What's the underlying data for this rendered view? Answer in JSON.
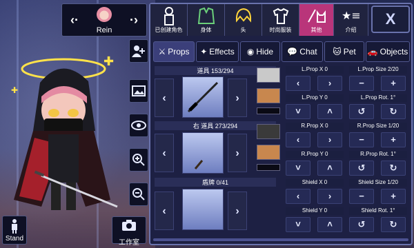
{
  "character": {
    "name": "Rein",
    "prev_icon": "chevron-left-icon",
    "next_icon": "chevron-right-icon"
  },
  "stand": {
    "label": "Stand"
  },
  "camera": {
    "label": "工作室"
  },
  "side_buttons": [
    "add-person-icon",
    "image-icon",
    "eye-icon",
    "zoom-in-icon",
    "zoom-out-icon"
  ],
  "categories": [
    {
      "label": "已创建角色"
    },
    {
      "label": "身体"
    },
    {
      "label": "头"
    },
    {
      "label": "时尚服装"
    },
    {
      "label": "其他",
      "active": true
    },
    {
      "label": "介绍"
    }
  ],
  "close_label": "X",
  "subtabs": [
    {
      "label": "Props",
      "active": true
    },
    {
      "label": "Effects"
    },
    {
      "label": "Hide"
    },
    {
      "label": "Chat"
    },
    {
      "label": "Pet"
    },
    {
      "label": "Objects"
    }
  ],
  "slots": [
    {
      "title": "道具 153/294",
      "color_top": "#c9c9c9",
      "color_bottom": "#c8874e"
    },
    {
      "title": "右 道具 273/294",
      "color_top": "#3a3a3a",
      "color_bottom": "#c8874e"
    },
    {
      "title": "盾牌 0/41"
    }
  ],
  "controls": [
    {
      "left": "L.Prop X 0",
      "right": "L.Prop Size 2/20",
      "type": "xy_size"
    },
    {
      "left": "L.Prop Y 0",
      "right": "L.Prop Rot. 1°",
      "type": "xy_rot"
    },
    {
      "left": "R.Prop X 0",
      "right": "R.Prop Size 1/20",
      "type": "xy_size"
    },
    {
      "left": "R.Prop Y 0",
      "right": "R.Prop Rot. 1°",
      "type": "xy_rot"
    },
    {
      "left": "Shield X 0",
      "right": "Shield Size 1/20",
      "type": "xy_size"
    },
    {
      "left": "Shield Y 0",
      "right": "Shield Rot. 1°",
      "type": "xy_rot"
    }
  ],
  "glyphs": {
    "left": "‹",
    "right": "›",
    "up": "˄",
    "down": "˅",
    "minus": "−",
    "plus": "+",
    "ccw": "↺",
    "cw": "↻"
  }
}
